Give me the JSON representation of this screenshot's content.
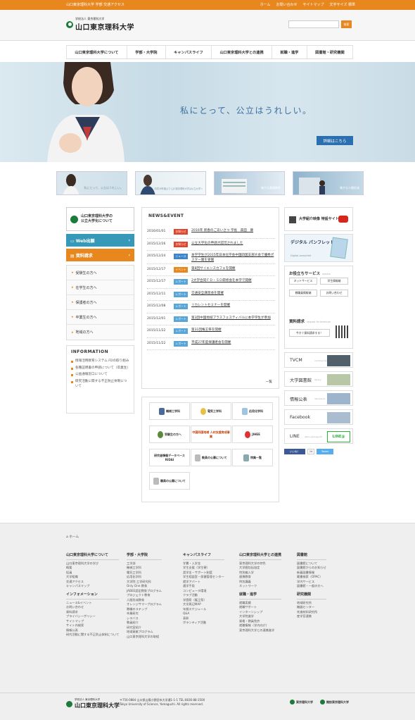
{
  "topbar": {
    "tag": "山口東京理科大学 学部 交通アクセス",
    "links": [
      "ホーム",
      "お問い合わせ",
      "サイトマップ",
      "文字サイズ 標準"
    ]
  },
  "header": {
    "logo_sub": "学校法人 東京理科大学",
    "logo_main": "山口東京理科大学",
    "search_placeholder": "",
    "search_button": "検索"
  },
  "nav": [
    "山口東京理科大学について",
    "学部・大学院",
    "キャンパスライフ",
    "山口東京理科大学との連携",
    "就職・進学",
    "図書館・研究機関"
  ],
  "hero": {
    "tagline": "私にとって、公立はうれしい。",
    "button": "詳細はこちら"
  },
  "banners": [
    "私にとって、公立はうれしい。",
    "平成28年度より 山口東京理科大学は公立大学へ",
    "確かな基礎教育",
    "確かな人間形成"
  ],
  "left": {
    "kodai_line1": "山口東京理科大学の",
    "kodai_line2": "公立大学化について",
    "web_app": "Web出願",
    "request": "資料請求",
    "audience": [
      "受験生の方へ",
      "在学生の方へ",
      "保護者の方へ",
      "卒業生の方へ",
      "地域の方へ"
    ],
    "info_head": "INFORMATION",
    "info_items": [
      "情報活用教育システム FDの取り組み",
      "各種証明書の申請について（卒業生）",
      "公益通報窓口について",
      "研究活動に関する不正防止体制について"
    ]
  },
  "news": {
    "head": "NEWS&EVENT",
    "more": "一覧",
    "items": [
      {
        "date": "2016/01/01",
        "badge": "お知らせ",
        "badge_color": "#e0452c",
        "title": "2016年 新春のごあいさつ 学長　森田　康"
      },
      {
        "date": "2015/12/26",
        "badge": "お知らせ",
        "badge_color": "#e0452c",
        "title": "公立大学化の申請が認可されました"
      },
      {
        "date": "2015/12/24",
        "badge": "ニュース",
        "badge_color": "#3f86c8",
        "title": "本学学生が2015年日本化学会中国四国支部大会で優秀ポスター賞を受賞"
      },
      {
        "date": "2015/12/17",
        "badge": "イベント",
        "badge_color": "#e8871e",
        "title": "第8回サイエンスカフェを開催"
      },
      {
        "date": "2015/12/17",
        "badge": "レポート",
        "badge_color": "#5aa5d8",
        "title": "2大学合同ＦＤ・ＳＤ研修会を本学で開催"
      },
      {
        "date": "2015/12/11",
        "badge": "レポート",
        "badge_color": "#5aa5d8",
        "title": "交通安全講習会を開催"
      },
      {
        "date": "2015/12/08",
        "badge": "レポート",
        "badge_color": "#5aa5d8",
        "title": "リカレントセミナーを開催"
      },
      {
        "date": "2015/12/01",
        "badge": "レポート",
        "badge_color": "#5aa5d8",
        "title": "第3回中国地域ブラスフェスティバルに本学学生が参加"
      },
      {
        "date": "2015/11/22",
        "badge": "レポート",
        "badge_color": "#5aa5d8",
        "title": "第31回権王祭を開催"
      },
      {
        "date": "2015/11/22",
        "badge": "レポート",
        "badge_color": "#5aa5d8",
        "title": "平成27年度保護者会を開催"
      }
    ]
  },
  "depts": [
    "機械工学科",
    "電気工学科",
    "応用化学科",
    "受験生の方へ",
    "中国四国地域 人材支援育成事業",
    "JIHEE",
    "研究者情報データベース RIDAI",
    "教員の公募について",
    "特集一覧",
    "職員の公募について"
  ],
  "right": {
    "video": "大学紹介映像 特設サイト",
    "pamph_title": "デジタル パンフレット",
    "pamph_sub": "Digital pamphlet",
    "useful_head": "お役立ちサービス",
    "useful_en": "service",
    "useful_buttons": [
      "ネットサービス",
      "学生情報端",
      "教職員情報端",
      "お問い合わせ"
    ],
    "request_head": "資料請求",
    "request_en": "request for brochure",
    "request_btn": "今すぐ資料請求する！",
    "links": [
      {
        "label": "TVCM",
        "en": "commercial",
        "color": "#51606a"
      },
      {
        "label": "大学図書館",
        "en": "library",
        "color": "#b8c8a6"
      },
      {
        "label": "情報公表",
        "en": "disclosure",
        "color": "#9db5cc"
      },
      {
        "label": "Facebook",
        "en": "",
        "color": "#a9bcd0"
      },
      {
        "label": "LINE",
        "en": "@tus-yamaguchi",
        "color": "#29b43c"
      }
    ],
    "fb_like": "いいね！",
    "fb_count": "24",
    "tweet": "Tweet"
  },
  "footer": {
    "crumb": "ホーム",
    "cols": [
      {
        "head": "山口東京理科大学について",
        "items": [
          "山口東京理科大学の学び",
          "概要",
          "役員",
          "大学組織",
          "交通アクセス",
          "キャンパスマップ"
        ],
        "head2": "インフォメーション",
        "items2": [
          "ニュース&イベント",
          "お問い合わせ",
          "資料請求",
          "プライバシーポリシー",
          "サイトマップ",
          "サイト内検索",
          "情報公表",
          "研究活動に関する不正防止体制について"
        ]
      },
      {
        "head": "学部・大学院",
        "items": [
          "工学部",
          "機械工学科",
          "電気工学科",
          "応用化学科",
          "大学院 工学研究科",
          "Only One 教育",
          "JABEE認定教育プログラム",
          "プロジェクト教育",
          "人間形成教育",
          "オレンジサマープログラム",
          "教職のステップ",
          "卒業研究",
          "シラバス",
          "教員紹介",
          "研究室紹介",
          "地域貢献プログラム",
          "山口東京理科大学の取組"
        ]
      },
      {
        "head": "キャンパスライフ",
        "items": [
          "学費・入学金",
          "学生支援（学生寮）",
          "奨学金・サポート制度",
          "学生相談室・保健管理センター",
          "就学アパート",
          "通学手段",
          "コンピュータ環境",
          "クラブ活動",
          "学園祭（権王祭）",
          "大学周辺MAP",
          "年間スケジュール",
          "Q&A",
          "表彰",
          "ボランティア活動"
        ]
      },
      {
        "head": "山口東京理科大学との連携",
        "items": [
          "東京理科大学の特色",
          "大学間包括協定",
          "特別編入学",
          "連携教育",
          "特別講義",
          "ネットワーク"
        ],
        "head2": "就職・進学",
        "items2": [
          "就職実績",
          "就職サポート",
          "インターンシップ",
          "大学院進学",
          "資格・教員免許",
          "就職情報（学内向け）",
          "東京理科大学との連携進学"
        ]
      },
      {
        "head": "図書館",
        "items": [
          "図書館について",
          "図書館からのお知らせ",
          "新着図書情報",
          "蔵書検索（OPAC）",
          "学内サービス",
          "図書館・一般の方へ"
        ],
        "head2": "研究機関",
        "items2": [
          "地域研究所",
          "機器センター",
          "先進材料研究所",
          "産学官連携"
        ]
      }
    ],
    "logo_sub": "学校法人 東京理科大学",
    "logo_main": "山口東京理科大学",
    "address": "〒756-0884 山口県山陽小野田市大学通1-1-1 TEL:0836-88-3500",
    "copyright": "Tokyo University of Science, Yamaguchi. All rights reserved.",
    "partner1": "東京理科大学",
    "partner2": "諏訪東京理科大学"
  }
}
